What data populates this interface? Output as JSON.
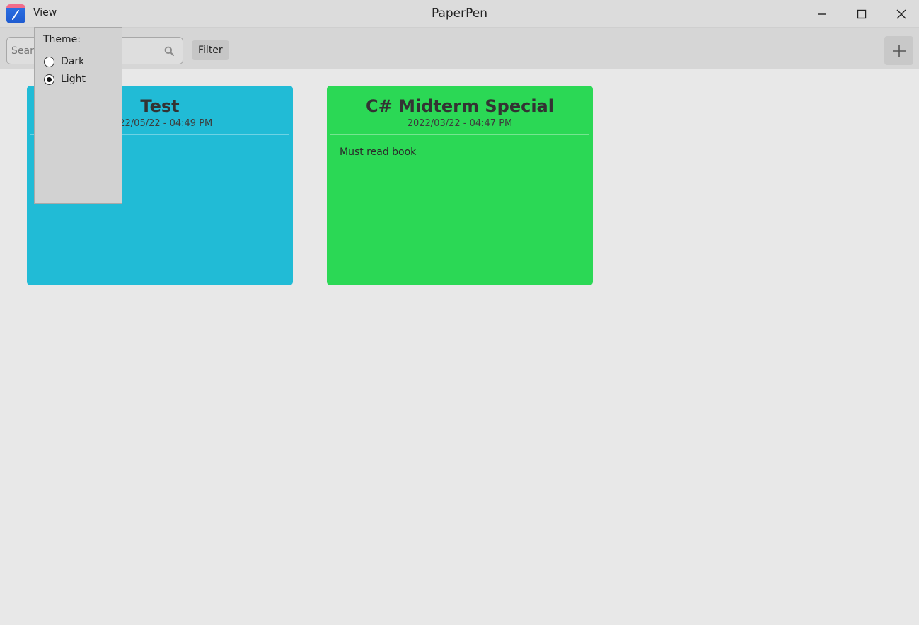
{
  "window": {
    "app_name": "PaperPen",
    "menu_view_label": "View",
    "controls": [
      "minimize-icon",
      "maximize-icon",
      "close-icon"
    ]
  },
  "toolbar": {
    "search_placeholder": "Search",
    "filter_label": "Filter",
    "add_icon": "plus-icon"
  },
  "theme_menu": {
    "label": "Theme:",
    "options": [
      {
        "label": "Dark",
        "selected": false
      },
      {
        "label": "Light",
        "selected": true
      }
    ]
  },
  "notes": [
    {
      "title": "Test",
      "date": "2022/05/22 - 04:49 PM",
      "body": "",
      "color": "#21bbd6"
    },
    {
      "title": "C# Midterm Special",
      "date": "2022/03/22 - 04:47 PM",
      "body": "Must read book",
      "color": "#2bd855"
    }
  ],
  "colors": {
    "background": "#e8e8e8",
    "titlebar": "#dcdcdc",
    "toolbar": "#d6d6d6"
  }
}
